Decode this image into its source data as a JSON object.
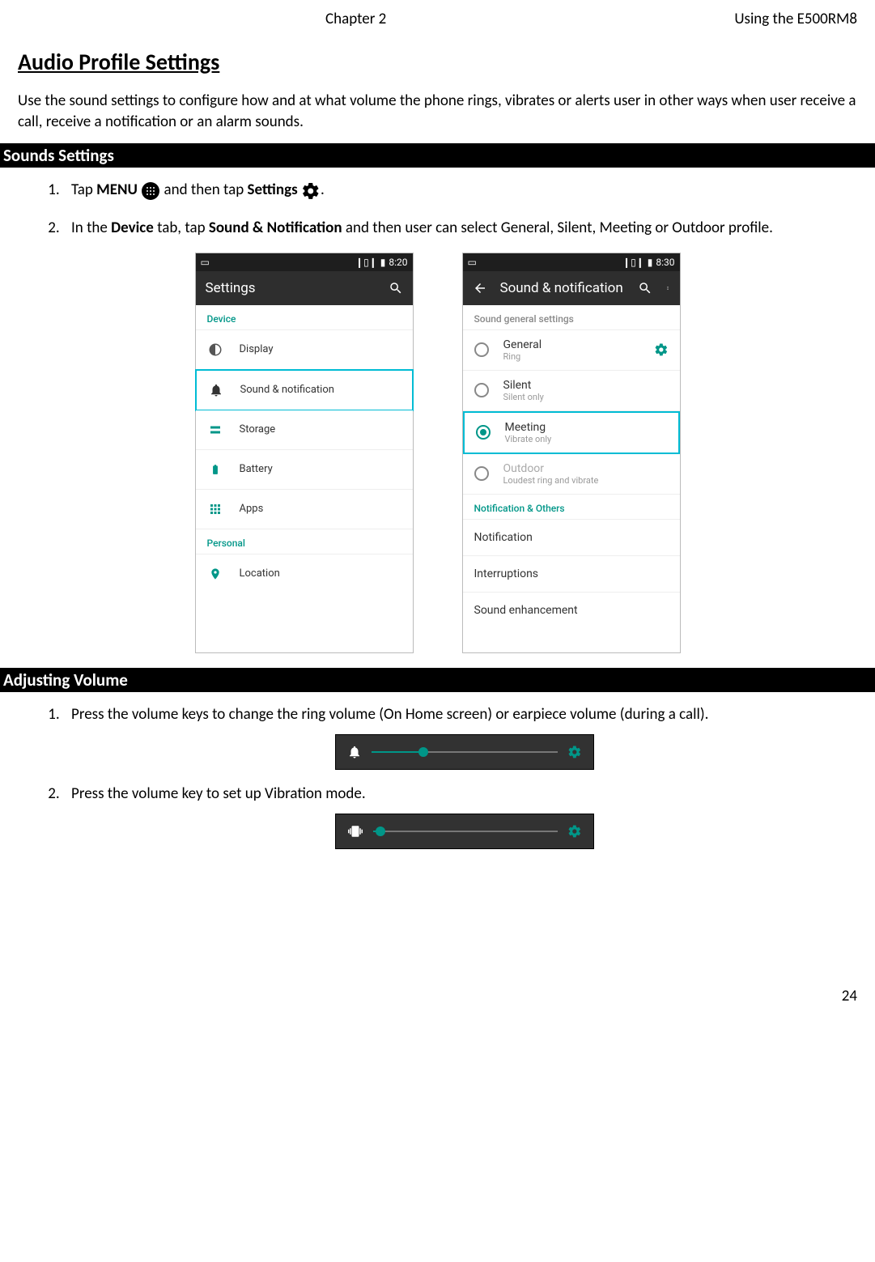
{
  "header": {
    "chapter": "Chapter 2",
    "using": "Using the E500RM8"
  },
  "title": "Audio Profile Settings",
  "intro": "Use the sound settings to configure how and at what volume the phone rings, vibrates or alerts user in other ways when user receive a call, receive a notification or an alarm sounds.",
  "bars": {
    "sounds": "Sounds Settings",
    "adjusting": "Adjusting Volume"
  },
  "steps1": {
    "one_a": "Tap ",
    "one_b": "MENU",
    "one_c": " and then tap ",
    "one_d": "Settings",
    "one_e": ".",
    "two_a": "In the ",
    "two_b": "Device",
    "two_c": " tab, tap ",
    "two_d": "Sound & Notification",
    "two_e": " and then user can select General, Silent, Meeting or Outdoor profile."
  },
  "phone1": {
    "time": "8:20",
    "title": "Settings",
    "sec_device": "Device",
    "items": {
      "display": "Display",
      "sound": "Sound & notification",
      "storage": "Storage",
      "battery": "Battery",
      "apps": "Apps"
    },
    "sec_personal": "Personal",
    "location": "Location"
  },
  "phone2": {
    "time": "8:30",
    "title": "Sound & notification",
    "sec_general": "Sound general settings",
    "profiles": {
      "general": {
        "t": "General",
        "s": "Ring"
      },
      "silent": {
        "t": "Silent",
        "s": "Silent only"
      },
      "meeting": {
        "t": "Meeting",
        "s": "Vibrate only"
      },
      "outdoor": {
        "t": "Outdoor",
        "s": "Loudest ring and vibrate"
      }
    },
    "sec_other": "Notification & Others",
    "rows": {
      "notification": "Notification",
      "interruptions": "Interruptions",
      "enhance": "Sound enhancement"
    }
  },
  "steps2": {
    "one": "Press the volume keys to change the ring volume (On Home screen) or earpiece volume (during a call).",
    "two": "Press the volume key to set up Vibration mode."
  },
  "volbars": {
    "ring_pct": 28,
    "vib_pct": 4
  },
  "page_number": "24"
}
